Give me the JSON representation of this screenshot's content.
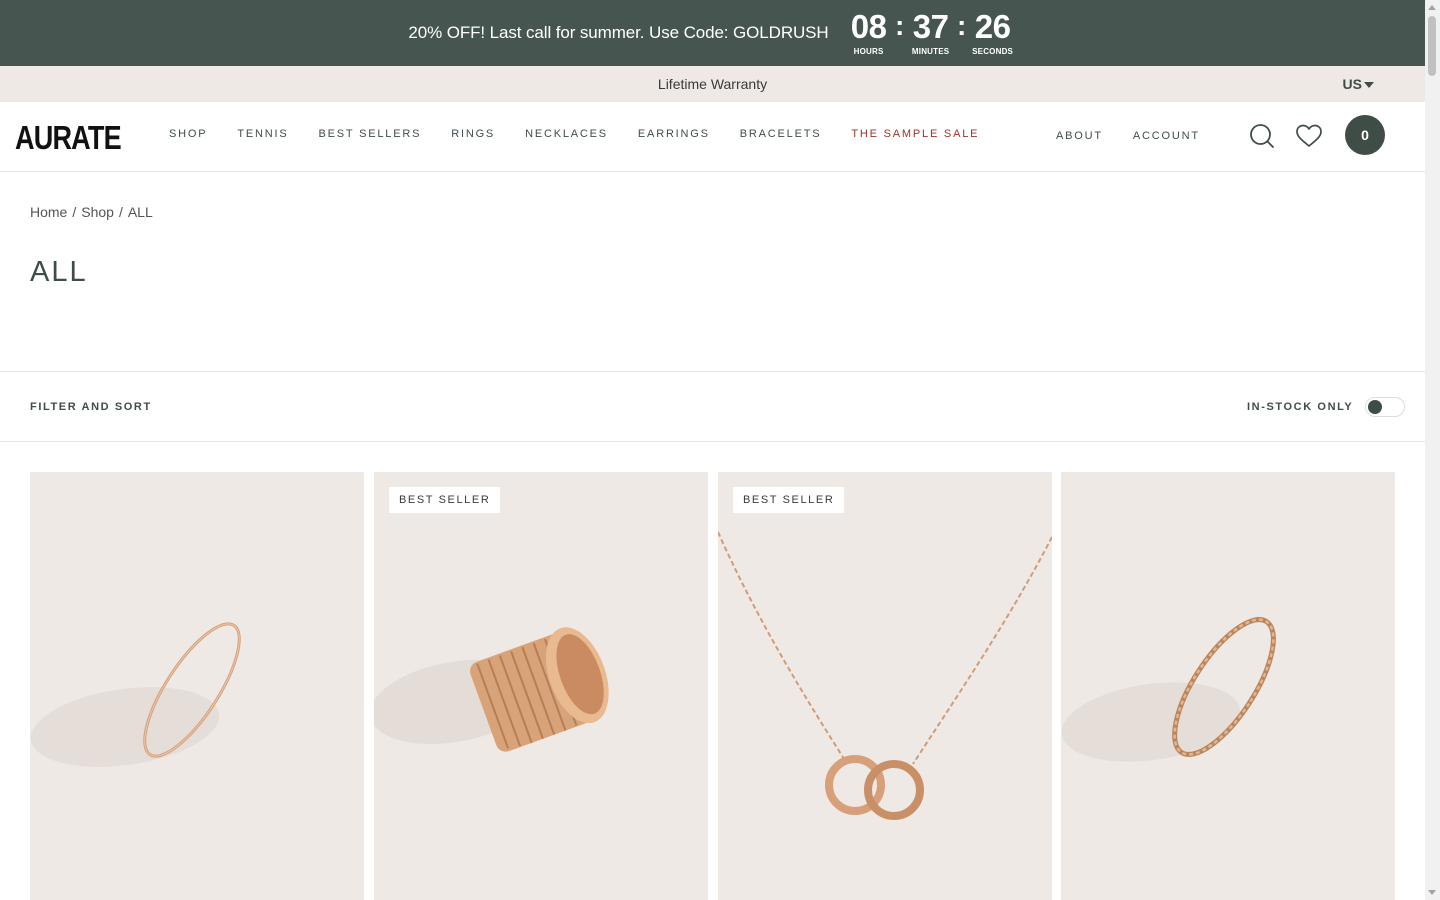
{
  "promo": {
    "text": "20% OFF! Last call for summer. Use Code: GOLDRUSH",
    "countdown": {
      "hours": "08",
      "hours_label": "HOURS",
      "minutes": "37",
      "minutes_label": "MINUTES",
      "seconds": "26",
      "seconds_label": "SECONDS",
      "separator": ":"
    }
  },
  "subbar": {
    "text": "Lifetime Warranty",
    "region": "US"
  },
  "header": {
    "logo": "AURATE",
    "nav": [
      "SHOP",
      "TENNIS",
      "BEST SELLERS",
      "RINGS",
      "NECKLACES",
      "EARRINGS",
      "BRACELETS",
      "THE SAMPLE SALE"
    ],
    "nav_right": [
      "ABOUT",
      "ACCOUNT"
    ],
    "cart_count": "0",
    "icons": [
      "search-icon",
      "heart-icon"
    ]
  },
  "breadcrumb": {
    "home": "Home",
    "sep": "/",
    "shop": "Shop",
    "current": "ALL"
  },
  "page_title": "ALL",
  "filters": {
    "filter_label": "FILTER AND SORT",
    "instock_label": "IN-STOCK ONLY",
    "instock_on": false
  },
  "products": [
    {
      "badge": "",
      "image": "thin-gold-ring"
    },
    {
      "badge": "BEST SELLER",
      "image": "ribbed-gold-band"
    },
    {
      "badge": "BEST SELLER",
      "image": "interlocking-circles-necklace"
    },
    {
      "badge": "",
      "image": "twisted-gold-ring"
    }
  ],
  "colors": {
    "primary": "#465550",
    "sale": "#9c3326",
    "card_bg": "#efe9e5",
    "gold": "#d9a37a"
  }
}
